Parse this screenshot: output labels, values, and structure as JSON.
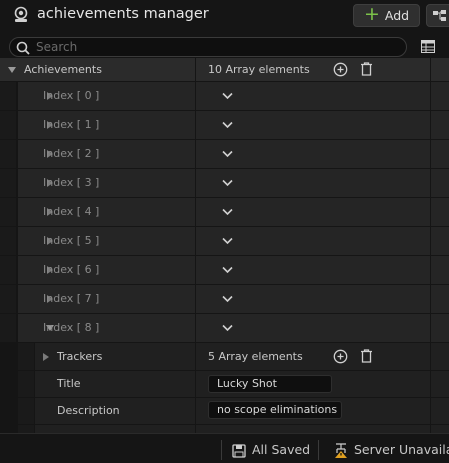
{
  "window": {
    "title": "achievements manager"
  },
  "toolbar": {
    "add_label": "Add"
  },
  "search": {
    "placeholder": "Search"
  },
  "achievements": {
    "label": "Achievements",
    "summary": "10 Array elements"
  },
  "indices": [
    "Index [ 0 ]",
    "Index [ 1 ]",
    "Index [ 2 ]",
    "Index [ 3 ]",
    "Index [ 4 ]",
    "Index [ 5 ]",
    "Index [ 6 ]",
    "Index [ 7 ]",
    "Index [ 8 ]"
  ],
  "expanded_index": 8,
  "item": {
    "trackers_label": "Trackers",
    "trackers_summary": "5 Array elements",
    "title_label": "Title",
    "title_value": "Lucky Shot",
    "description_label": "Description",
    "description_value": "no scope eliminations"
  },
  "status": {
    "saved": "All Saved",
    "server": "Server Unavailab"
  },
  "colors": {
    "add_plus": "#7cc24a",
    "warning": "#e0a020"
  }
}
